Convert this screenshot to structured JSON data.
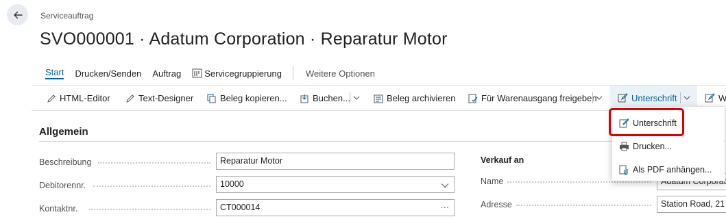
{
  "page": {
    "caption": "Serviceauftrag",
    "title": "SVO000001 · Adatum Corporation · Reparatur Motor"
  },
  "tabs": [
    {
      "label": "Start"
    },
    {
      "label": "Drucken/Senden"
    },
    {
      "label": "Auftrag"
    },
    {
      "label": "Servicegruppierung"
    },
    {
      "label": "Weitere Optionen"
    }
  ],
  "actions": {
    "html_editor": "HTML-Editor",
    "text_designer": "Text-Designer",
    "copy_doc": "Beleg kopieren...",
    "post": "Buchen...",
    "archive": "Beleg archivieren",
    "release": "Für Warenausgang freigeben",
    "signature": "Unterschrift",
    "overflow": "W"
  },
  "section": {
    "title": "Allgemein"
  },
  "fields": {
    "description": {
      "label": "Beschreibung",
      "value": "Reparatur Motor"
    },
    "customer_no": {
      "label": "Debitorennr.",
      "value": "10000"
    },
    "contact_no": {
      "label": "Kontaktnr.",
      "value": "CT000014",
      "trail": "···"
    }
  },
  "sell_to": {
    "heading": "Verkauf an",
    "name_label": "Name",
    "name_value": "Adatum Corporation",
    "address_label": "Adresse",
    "address_value": "Station Road, 21"
  },
  "dropdown": {
    "items": [
      {
        "label": "Unterschrift"
      },
      {
        "label": "Drucken..."
      },
      {
        "label": "Als PDF anhängen..."
      }
    ]
  },
  "colors": {
    "accent": "#00639a",
    "highlight_border": "#e00000"
  }
}
